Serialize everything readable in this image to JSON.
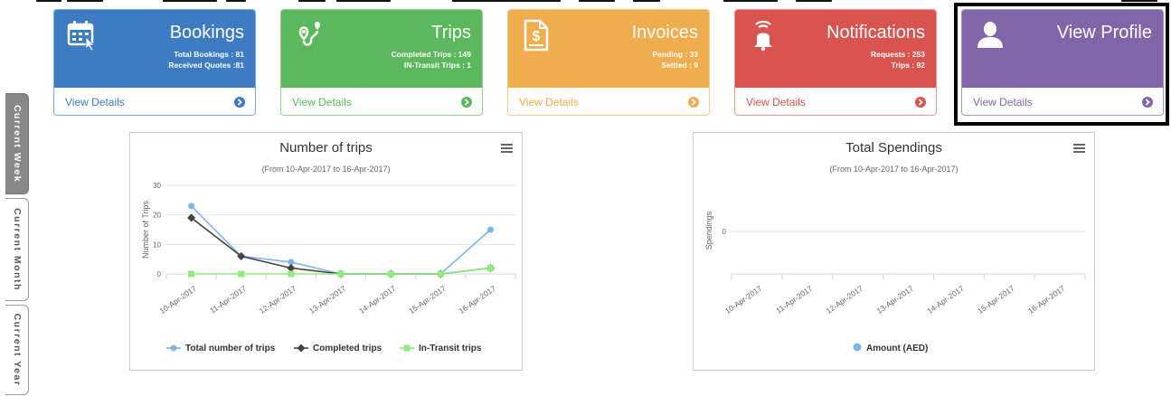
{
  "tiles": [
    {
      "title": "Bookings",
      "line1": "Total Bookings : 81",
      "line2": "Received Quotes :81",
      "link": "View Details",
      "color": "#3d7bc3",
      "border": "#7aaadb",
      "icon": "calendar-icon"
    },
    {
      "title": "Trips",
      "line1": "Completed Trips : 149",
      "line2": "IN-Transit Trips : 1",
      "link": "View Details",
      "color": "#5cb85c",
      "border": "#92cf92",
      "icon": "map-route-icon"
    },
    {
      "title": "Invoices",
      "line1": "Pending : 33",
      "line2": "Settled : 9",
      "link": "View Details",
      "color": "#f0ad4e",
      "border": "#f4c98c",
      "icon": "invoice-dollar-icon"
    },
    {
      "title": "Notifications",
      "line1": "Requests : 253",
      "line2": "Trips : 92",
      "link": "View Details",
      "color": "#d9534f",
      "border": "#e79693",
      "icon": "bell-icon"
    },
    {
      "title": "View Profile",
      "line1": "",
      "line2": "",
      "link": "View Details",
      "color": "#8065a8",
      "border": "#a892c8",
      "icon": "user-icon"
    }
  ],
  "side_tabs": [
    "Current Week",
    "Current Month",
    "Current Year"
  ],
  "charts": [
    {
      "title": "Number of trips",
      "subtitle": "(From 10-Apr-2017 to 16-Apr-2017)",
      "ylabel": "Number of Trips"
    },
    {
      "title": "Total Spendings",
      "subtitle": "(From 10-Apr-2017 to 16-Apr-2017)",
      "ylabel": "Spendings"
    }
  ],
  "chart_data": [
    {
      "type": "line",
      "title": "Number of trips",
      "subtitle": "(From 10-Apr-2017 to 16-Apr-2017)",
      "ylabel": "Number of Trips",
      "x": [
        "10-Apr-2017",
        "11-Apr-2017",
        "12-Apr-2017",
        "13-Apr-2017",
        "14-Apr-2017",
        "15-Apr-2017",
        "16-Apr-2017"
      ],
      "yticks": [
        0,
        10,
        20,
        30
      ],
      "ylim": [
        0,
        30
      ],
      "series": [
        {
          "name": "Total number of trips",
          "color": "#7cb5ec",
          "marker": "circle",
          "values": [
            23,
            6,
            4,
            0,
            0,
            0,
            15
          ]
        },
        {
          "name": "Completed trips",
          "color": "#434348",
          "marker": "diamond",
          "values": [
            19,
            6,
            2,
            0,
            0,
            0,
            2
          ]
        },
        {
          "name": "In-Transit trips",
          "color": "#90ed7d",
          "marker": "square",
          "values": [
            0,
            0,
            0,
            0,
            0,
            0,
            2
          ]
        }
      ],
      "legend": "bottom"
    },
    {
      "type": "line",
      "title": "Total Spendings",
      "subtitle": "(From 10-Apr-2017 to 16-Apr-2017)",
      "ylabel": "Spendings",
      "x": [
        "10-Apr-2017",
        "11-Apr-2017",
        "12-Apr-2017",
        "13-Apr-2017",
        "14-Apr-2017",
        "15-Apr-2017",
        "16-Apr-2017"
      ],
      "yticks": [
        0
      ],
      "series": [
        {
          "name": "Amount (AED)",
          "color": "#7cb5ec",
          "marker": "circle",
          "values": []
        }
      ],
      "legend": "bottom"
    }
  ]
}
